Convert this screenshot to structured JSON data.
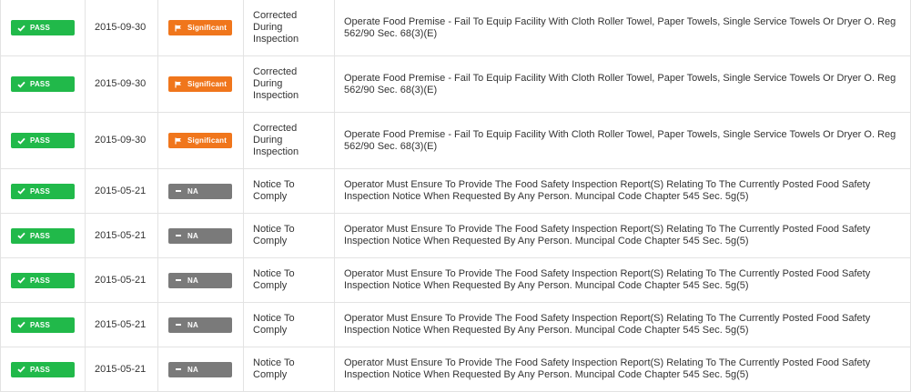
{
  "colors": {
    "pass": "#21b94a",
    "significant": "#f0761c",
    "na": "#7a7a7a",
    "border": "#e3e3e3"
  },
  "rows": [
    {
      "result": {
        "label": "PASS",
        "icon": "check-icon"
      },
      "date": "2015-09-30",
      "severity": {
        "label": "Significant",
        "icon": "flag-icon",
        "kind": "significant"
      },
      "action": "Corrected During Inspection",
      "description": "Operate Food Premise - Fail To Equip Facility With Cloth Roller Towel, Paper Towels, Single Service Towels Or Dryer O. Reg 562/90 Sec. 68(3)(E)"
    },
    {
      "result": {
        "label": "PASS",
        "icon": "check-icon"
      },
      "date": "2015-09-30",
      "severity": {
        "label": "Significant",
        "icon": "flag-icon",
        "kind": "significant"
      },
      "action": "Corrected During Inspection",
      "description": "Operate Food Premise - Fail To Equip Facility With Cloth Roller Towel, Paper Towels, Single Service Towels Or Dryer O. Reg 562/90 Sec. 68(3)(E)"
    },
    {
      "result": {
        "label": "PASS",
        "icon": "check-icon"
      },
      "date": "2015-09-30",
      "severity": {
        "label": "Significant",
        "icon": "flag-icon",
        "kind": "significant"
      },
      "action": "Corrected During Inspection",
      "description": "Operate Food Premise - Fail To Equip Facility With Cloth Roller Towel, Paper Towels, Single Service Towels Or Dryer O. Reg 562/90 Sec. 68(3)(E)"
    },
    {
      "result": {
        "label": "PASS",
        "icon": "check-icon"
      },
      "date": "2015-05-21",
      "severity": {
        "label": "NA",
        "icon": "minus-icon",
        "kind": "na"
      },
      "action": "Notice To Comply",
      "description": "Operator Must Ensure To Provide The Food Safety Inspection Report(S) Relating To The Currently Posted Food Safety Inspection Notice When Requested By Any Person. Muncipal Code Chapter 545 Sec. 5g(5)"
    },
    {
      "result": {
        "label": "PASS",
        "icon": "check-icon"
      },
      "date": "2015-05-21",
      "severity": {
        "label": "NA",
        "icon": "minus-icon",
        "kind": "na"
      },
      "action": "Notice To Comply",
      "description": "Operator Must Ensure To Provide The Food Safety Inspection Report(S) Relating To The Currently Posted Food Safety Inspection Notice When Requested By Any Person. Muncipal Code Chapter 545 Sec. 5g(5)"
    },
    {
      "result": {
        "label": "PASS",
        "icon": "check-icon"
      },
      "date": "2015-05-21",
      "severity": {
        "label": "NA",
        "icon": "minus-icon",
        "kind": "na"
      },
      "action": "Notice To Comply",
      "description": "Operator Must Ensure To Provide The Food Safety Inspection Report(S) Relating To The Currently Posted Food Safety Inspection Notice When Requested By Any Person. Muncipal Code Chapter 545 Sec. 5g(5)"
    },
    {
      "result": {
        "label": "PASS",
        "icon": "check-icon"
      },
      "date": "2015-05-21",
      "severity": {
        "label": "NA",
        "icon": "minus-icon",
        "kind": "na"
      },
      "action": "Notice To Comply",
      "description": "Operator Must Ensure To Provide The Food Safety Inspection Report(S) Relating To The Currently Posted Food Safety Inspection Notice When Requested By Any Person. Muncipal Code Chapter 545 Sec. 5g(5)"
    },
    {
      "result": {
        "label": "PASS",
        "icon": "check-icon"
      },
      "date": "2015-05-21",
      "severity": {
        "label": "NA",
        "icon": "minus-icon",
        "kind": "na"
      },
      "action": "Notice To Comply",
      "description": "Operator Must Ensure To Provide The Food Safety Inspection Report(S) Relating To The Currently Posted Food Safety Inspection Notice When Requested By Any Person. Muncipal Code Chapter 545 Sec. 5g(5)"
    }
  ]
}
